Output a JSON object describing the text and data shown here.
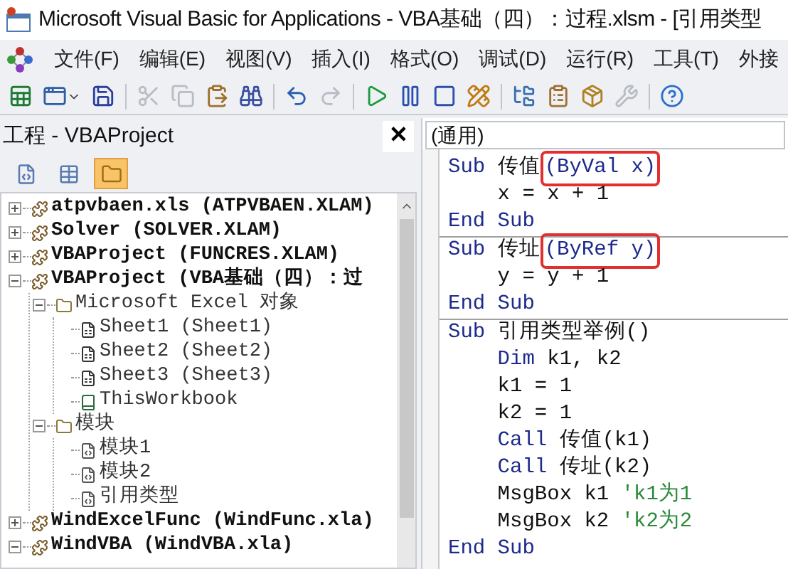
{
  "window": {
    "title": "Microsoft Visual Basic for Applications - VBA基础（四）：过程.xlsm - [引用类型"
  },
  "menu": [
    "文件(F)",
    "编辑(E)",
    "视图(V)",
    "插入(I)",
    "格式(O)",
    "调试(D)",
    "运行(R)",
    "工具(T)",
    "外接"
  ],
  "toolbar": [
    {
      "kind": "excel",
      "disabled": false
    },
    {
      "kind": "userform",
      "disabled": false
    },
    {
      "kind": "save",
      "disabled": false
    },
    {
      "kind": "sep"
    },
    {
      "kind": "cut",
      "disabled": true
    },
    {
      "kind": "copy",
      "disabled": true
    },
    {
      "kind": "paste",
      "disabled": false
    },
    {
      "kind": "find",
      "disabled": false
    },
    {
      "kind": "sep"
    },
    {
      "kind": "undo",
      "disabled": false
    },
    {
      "kind": "redo",
      "disabled": true
    },
    {
      "kind": "sep"
    },
    {
      "kind": "run",
      "disabled": false
    },
    {
      "kind": "pause",
      "disabled": false
    },
    {
      "kind": "stop",
      "disabled": false
    },
    {
      "kind": "design",
      "disabled": false
    },
    {
      "kind": "sep"
    },
    {
      "kind": "project",
      "disabled": false
    },
    {
      "kind": "properties",
      "disabled": false
    },
    {
      "kind": "objects",
      "disabled": false
    },
    {
      "kind": "toolbox",
      "disabled": true
    },
    {
      "kind": "sep"
    },
    {
      "kind": "help",
      "disabled": false
    }
  ],
  "project_pane": {
    "title": "工程 - VBAProject",
    "close": "✕",
    "view_buttons": [
      {
        "kind": "code",
        "selected": false
      },
      {
        "kind": "object",
        "selected": false
      },
      {
        "kind": "folders",
        "selected": true
      }
    ],
    "tree": [
      {
        "label": "atpvbaen.xls (ATPVBAEN.XLAM)",
        "kind": "project",
        "expanded": false
      },
      {
        "label": "Solver (SOLVER.XLAM)",
        "kind": "project",
        "expanded": false
      },
      {
        "label": "VBAProject (FUNCRES.XLAM)",
        "kind": "project",
        "expanded": false
      },
      {
        "label": "VBAProject (VBA基础（四）：过",
        "kind": "project",
        "expanded": true,
        "children": [
          {
            "label": "Microsoft Excel 对象",
            "kind": "folder",
            "expanded": true,
            "children": [
              {
                "label": "Sheet1 (Sheet1)",
                "kind": "sheet"
              },
              {
                "label": "Sheet2 (Sheet2)",
                "kind": "sheet"
              },
              {
                "label": "Sheet3 (Sheet3)",
                "kind": "sheet"
              },
              {
                "label": "ThisWorkbook",
                "kind": "workbook"
              }
            ]
          },
          {
            "label": "模块",
            "kind": "folder",
            "expanded": true,
            "children": [
              {
                "label": "模块1",
                "kind": "module"
              },
              {
                "label": "模块2",
                "kind": "module"
              },
              {
                "label": "引用类型",
                "kind": "module"
              }
            ]
          }
        ]
      },
      {
        "label": "WindExcelFunc (WindFunc.xla)",
        "kind": "project",
        "expanded": false
      },
      {
        "label": "WindVBA (WindVBA.xla)",
        "kind": "project",
        "expanded": true
      }
    ]
  },
  "code_pane": {
    "object_dropdown": "(通用)",
    "procedures": [
      {
        "lines": [
          [
            {
              "kind": "keyword",
              "text": "Sub"
            },
            {
              "kind": "plain",
              "text": " 传值"
            },
            {
              "kind": "boxed",
              "text": "(ByVal x)"
            }
          ],
          [
            {
              "kind": "plain",
              "text": "    x = x + 1"
            }
          ],
          [
            {
              "kind": "keyword",
              "text": "End Sub"
            }
          ]
        ]
      },
      {
        "lines": [
          [
            {
              "kind": "keyword",
              "text": "Sub"
            },
            {
              "kind": "plain",
              "text": " 传址"
            },
            {
              "kind": "boxed",
              "text": "(ByRef y)"
            }
          ],
          [
            {
              "kind": "plain",
              "text": "    y = y + 1"
            }
          ],
          [
            {
              "kind": "keyword",
              "text": "End Sub"
            }
          ]
        ]
      },
      {
        "lines": [
          [
            {
              "kind": "keyword",
              "text": "Sub"
            },
            {
              "kind": "plain",
              "text": " 引用类型举例()"
            }
          ],
          [
            {
              "kind": "keyword",
              "text": "    Dim"
            },
            {
              "kind": "plain",
              "text": " k1, k2"
            }
          ],
          [
            {
              "kind": "plain",
              "text": "    k1 = 1"
            }
          ],
          [
            {
              "kind": "plain",
              "text": "    k2 = 1"
            }
          ],
          [
            {
              "kind": "keyword",
              "text": "    Call"
            },
            {
              "kind": "plain",
              "text": " 传值(k1)"
            }
          ],
          [
            {
              "kind": "keyword",
              "text": "    Call"
            },
            {
              "kind": "plain",
              "text": " 传址(k2)"
            }
          ],
          [
            {
              "kind": "plain",
              "text": "    MsgBox k1 "
            },
            {
              "kind": "comment",
              "text": "'k1为1"
            }
          ],
          [
            {
              "kind": "plain",
              "text": "    MsgBox k2 "
            },
            {
              "kind": "comment",
              "text": "'k2为2"
            }
          ],
          [
            {
              "kind": "keyword",
              "text": "End Sub"
            }
          ]
        ]
      }
    ]
  }
}
